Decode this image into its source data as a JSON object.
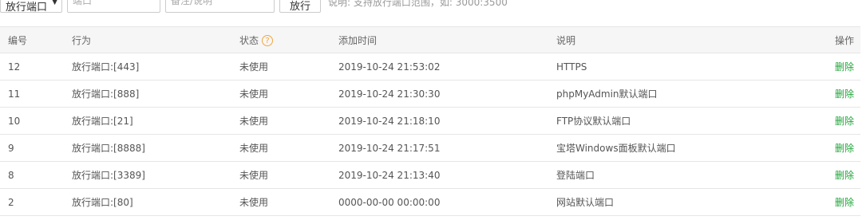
{
  "toolbar": {
    "type_select": "放行端口",
    "port_placeholder": "端口",
    "note_placeholder": "备注/说明",
    "submit_label": "放行",
    "hint": "说明: 支持放行端口范围，如: 3000:3500"
  },
  "table": {
    "headers": {
      "id": "编号",
      "action": "行为",
      "status": "状态",
      "time": "添加时间",
      "desc": "说明",
      "ops": "操作"
    },
    "status_help_icon": "?",
    "rows": [
      {
        "id": "12",
        "action": "放行端口:[443]",
        "status": "未使用",
        "time": "2019-10-24 21:53:02",
        "desc": "HTTPS",
        "op": "删除"
      },
      {
        "id": "11",
        "action": "放行端口:[888]",
        "status": "未使用",
        "time": "2019-10-24 21:30:30",
        "desc": "phpMyAdmin默认端口",
        "op": "删除"
      },
      {
        "id": "10",
        "action": "放行端口:[21]",
        "status": "未使用",
        "time": "2019-10-24 21:18:10",
        "desc": "FTP协议默认端口",
        "op": "删除"
      },
      {
        "id": "9",
        "action": "放行端口:[8888]",
        "status": "未使用",
        "time": "2019-10-24 21:17:51",
        "desc": "宝塔Windows面板默认端口",
        "op": "删除"
      },
      {
        "id": "8",
        "action": "放行端口:[3389]",
        "status": "未使用",
        "time": "2019-10-24 21:13:40",
        "desc": "登陆端口",
        "op": "删除"
      },
      {
        "id": "2",
        "action": "放行端口:[80]",
        "status": "未使用",
        "time": "0000-00-00 00:00:00",
        "desc": "网站默认端口",
        "op": "删除"
      }
    ]
  },
  "colors": {
    "accent_green": "#20a53a",
    "help_orange": "#f0a73e",
    "header_bg": "#f6f6f6"
  }
}
